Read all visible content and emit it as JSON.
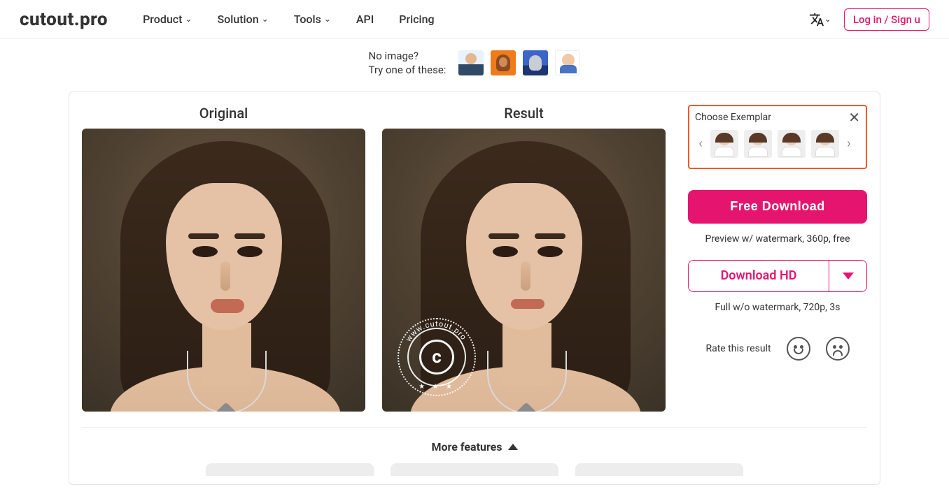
{
  "header": {
    "logo": "cutout.pro",
    "nav": {
      "product": "Product",
      "solution": "Solution",
      "tools": "Tools",
      "api": "API",
      "pricing": "Pricing"
    },
    "login": "Log in / Sign u"
  },
  "tryRow": {
    "line1": "No image?",
    "line2": "Try one of these:"
  },
  "compare": {
    "originalTitle": "Original",
    "resultTitle": "Result",
    "watermarkText": "www.cutout.pro",
    "watermarkLetter": "c"
  },
  "exemplar": {
    "title": "Choose Exemplar"
  },
  "actions": {
    "freeDownload": "Free Download",
    "freeNote": "Preview w/ watermark, 360p, free",
    "downloadHD": "Download HD",
    "hdNote": "Full w/o watermark, 720p, 3s",
    "rateLabel": "Rate this result"
  },
  "more": {
    "title": "More features"
  }
}
